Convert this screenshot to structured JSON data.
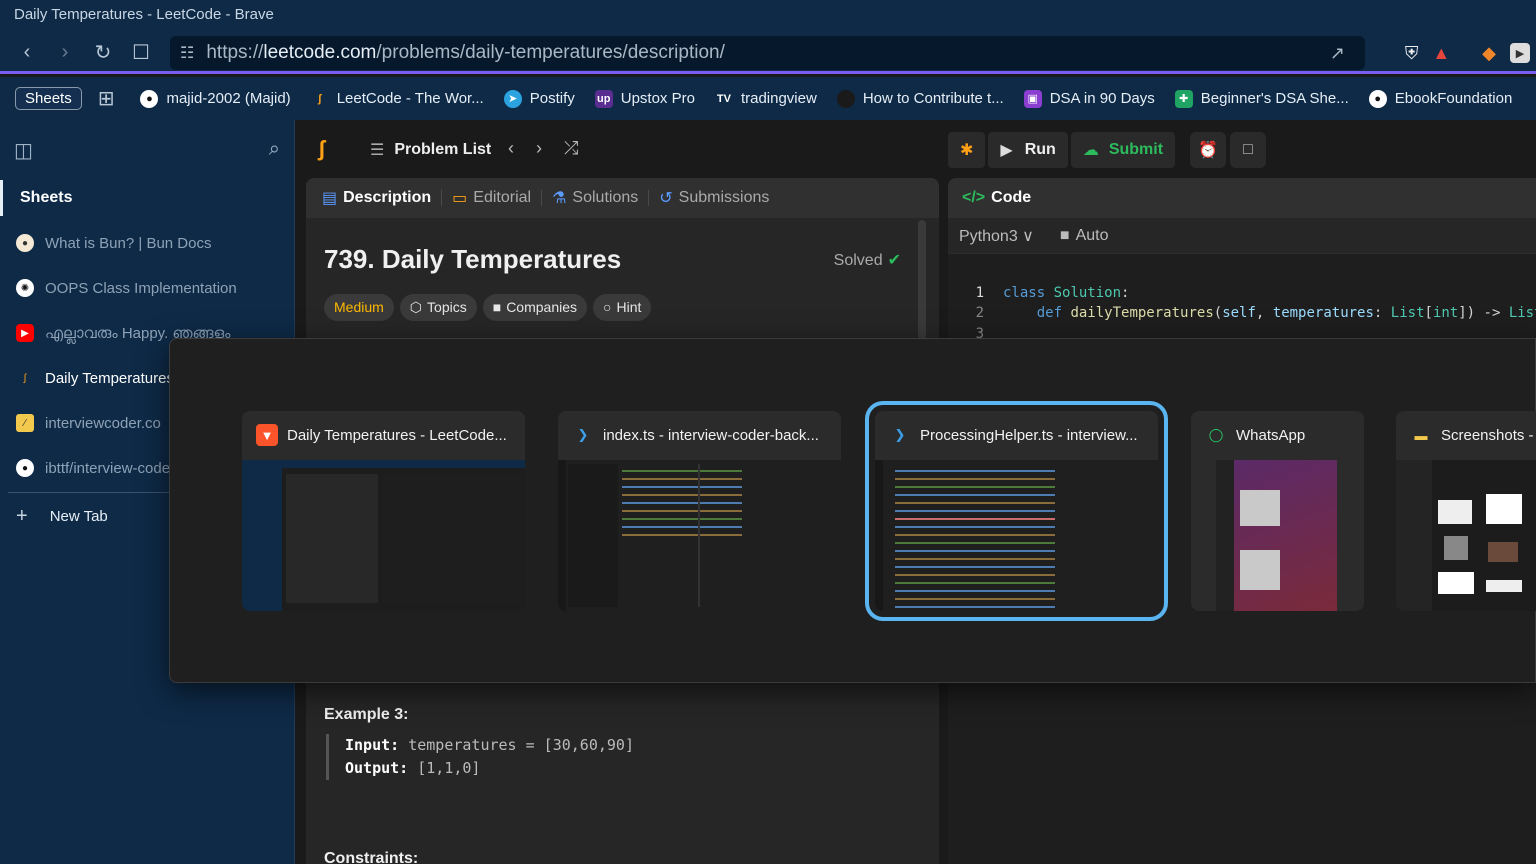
{
  "window": {
    "title": "Daily Temperatures - LeetCode - Brave"
  },
  "nav": {
    "url_prefix": "https://",
    "url_host": "leetcode.com",
    "url_path": "/problems/daily-temperatures/description/"
  },
  "bookmarks": {
    "sheets_label": "Sheets",
    "items": [
      {
        "label": "majid-2002 (Majid)",
        "icon": "github-icon"
      },
      {
        "label": "LeetCode - The Wor...",
        "icon": "leetcode-icon"
      },
      {
        "label": "Postify",
        "icon": "telegram-icon"
      },
      {
        "label": "Upstox Pro",
        "icon": "upstox-icon"
      },
      {
        "label": "tradingview",
        "icon": "tradingview-icon"
      },
      {
        "label": "How to Contribute t...",
        "icon": "globe-icon"
      },
      {
        "label": "DSA in 90 Days",
        "icon": "twitch-icon"
      },
      {
        "label": "Beginner's DSA She...",
        "icon": "sheets-icon"
      },
      {
        "label": "EbookFoundation",
        "icon": "github-icon"
      }
    ]
  },
  "sidebar": {
    "section": "Sheets",
    "items": [
      {
        "label": "What is Bun? | Bun Docs",
        "icon": "bun-icon"
      },
      {
        "label": "OOPS Class Implementation",
        "icon": "openai-icon"
      },
      {
        "label": "എല്ലാവരും Happy. ഞങ്ങളും",
        "icon": "youtube-icon"
      },
      {
        "label": "Daily Temperatures",
        "icon": "leetcode-icon"
      },
      {
        "label": "interviewcoder.co",
        "icon": "interviewcoder-icon"
      },
      {
        "label": "ibttf/interview-code",
        "icon": "github-icon"
      }
    ],
    "new_tab": "New Tab"
  },
  "leetcode": {
    "problem_list": "Problem List",
    "run": "Run",
    "submit": "Submit",
    "tabs": [
      "Description",
      "Editorial",
      "Solutions",
      "Submissions"
    ],
    "title": "739. Daily Temperatures",
    "solved": "Solved",
    "chips": [
      "Medium",
      "Topics",
      "Companies",
      "Hint"
    ],
    "example_title": "Example 3:",
    "example_input_label": "Input:",
    "example_input": "temperatures = [30,60,90]",
    "example_output_label": "Output:",
    "example_output": "[1,1,0]",
    "constraints": "Constraints:",
    "code_tab": "Code",
    "language": "Python3",
    "auto": "Auto",
    "line_numbers": [
      "1",
      "2",
      "3"
    ]
  },
  "switcher": {
    "cards": [
      {
        "title": "Daily Temperatures - LeetCode...",
        "icon": "brave-icon"
      },
      {
        "title": "index.ts - interview-coder-back...",
        "icon": "vscode-icon"
      },
      {
        "title": "ProcessingHelper.ts - interview...",
        "icon": "vscode-icon"
      },
      {
        "title": "WhatsApp",
        "icon": "whatsapp-icon"
      },
      {
        "title": "Screenshots -",
        "icon": "folder-icon"
      }
    ]
  }
}
